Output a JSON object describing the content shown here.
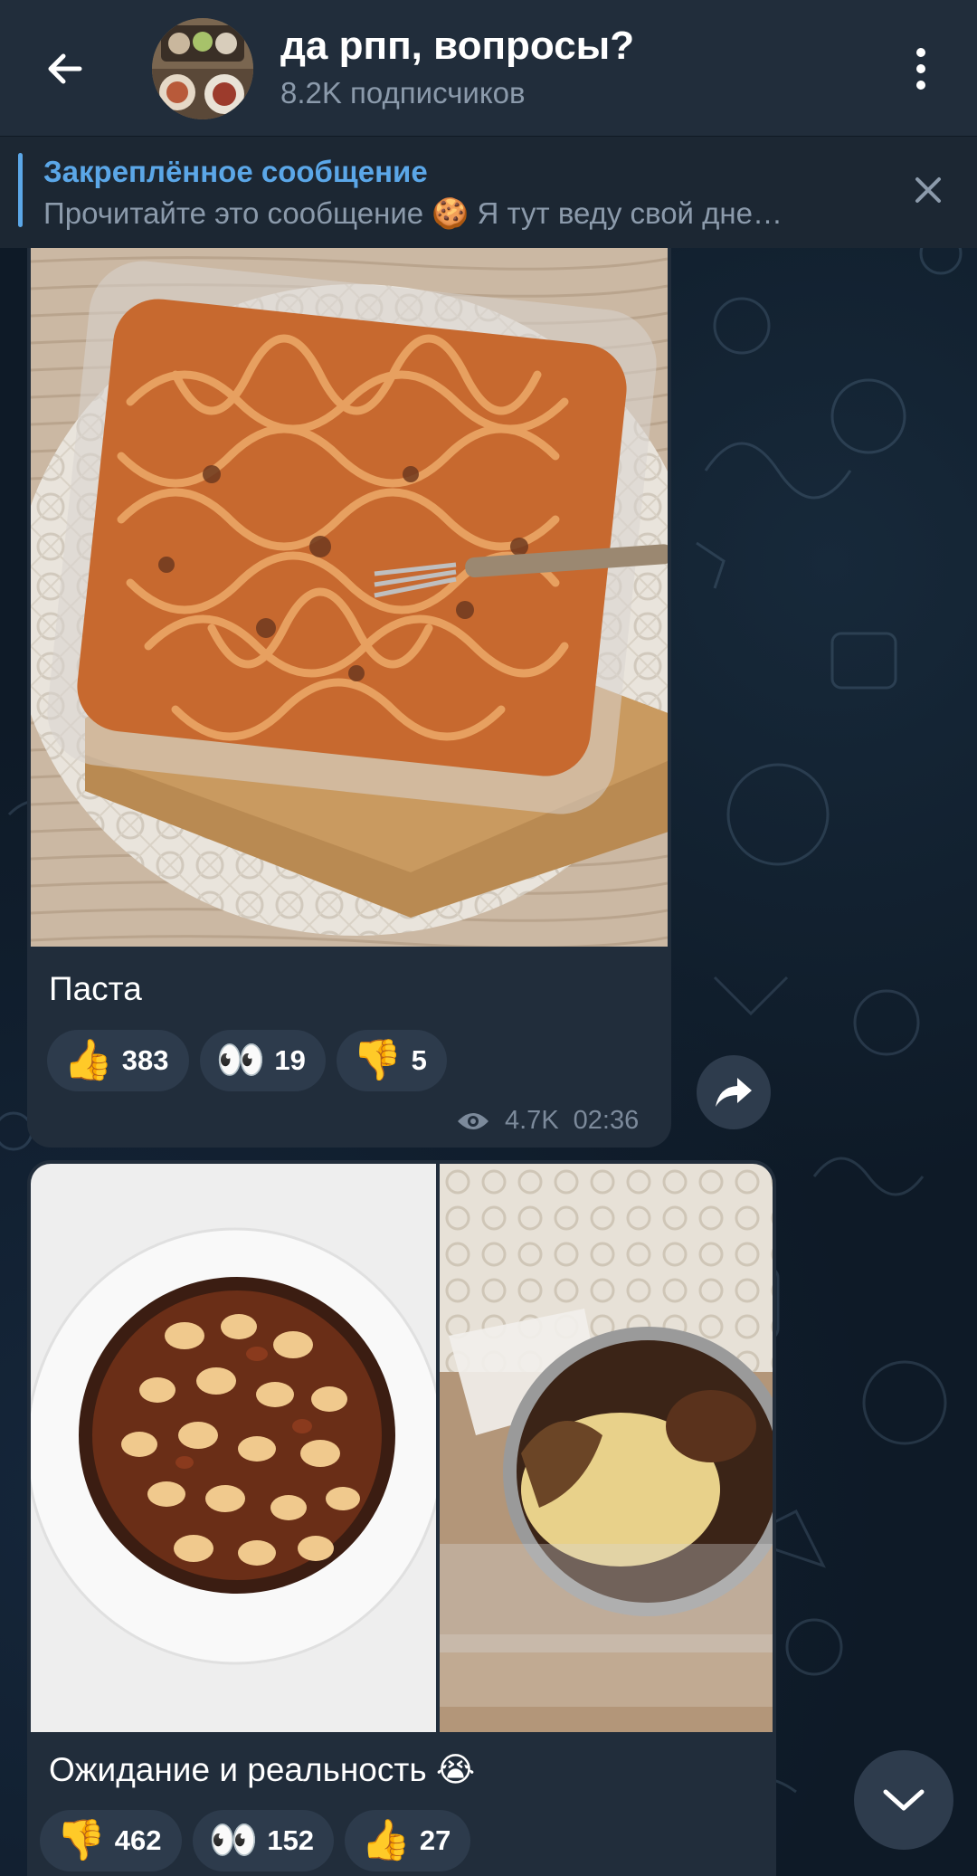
{
  "header": {
    "title": "да рпп, вопросы?",
    "subscribers": "8.2K подписчиков"
  },
  "pinned": {
    "title": "Закреплённое сообщение",
    "text": "Прочитайте это сообщение 🍪  Я тут веду свой дне…"
  },
  "messages": [
    {
      "caption": "Паста",
      "reactions": [
        {
          "emoji": "👍",
          "count": "383"
        },
        {
          "emoji": "👀",
          "count": "19"
        },
        {
          "emoji": "👎",
          "count": "5"
        }
      ],
      "views": "4.7K",
      "time": "02:36"
    },
    {
      "caption": "Ожидание и реальность 😭",
      "reactions": [
        {
          "emoji": "👎",
          "count": "462"
        },
        {
          "emoji": "👀",
          "count": "152"
        },
        {
          "emoji": "👍",
          "count": "27"
        }
      ]
    }
  ],
  "colors": {
    "header_bg": "#212d3b",
    "bubble_bg": "#212d3b",
    "accent": "#5ba7e8",
    "muted_text": "#8b9aab"
  },
  "icons": {
    "back": "arrow-left-icon",
    "menu": "more-vertical-icon",
    "close": "close-icon",
    "views": "eye-icon",
    "share": "share-icon",
    "scroll": "chevron-down-icon"
  }
}
